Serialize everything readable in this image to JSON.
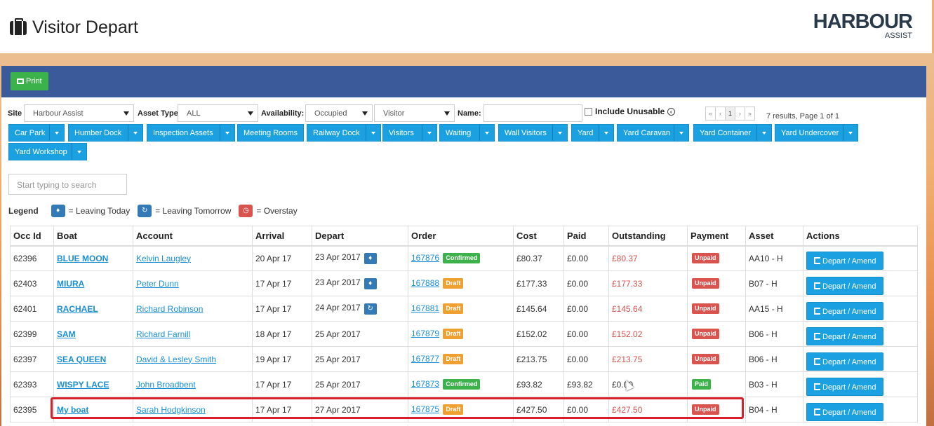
{
  "header": {
    "title": "Visitor Depart",
    "logo_main": "HARBOUR",
    "logo_sub": "ASSIST"
  },
  "toolbar": {
    "print_label": "Print"
  },
  "filters": {
    "site_label": "Site",
    "site_value": "Harbour Assist",
    "asset_type_label": "Asset Type",
    "asset_type_value": "ALL",
    "availability_label": "Availability:",
    "availability_value": "Occupied",
    "visitor_value": "Visitor",
    "name_label": "Name:",
    "name_value": "",
    "include_unusable_label": "Include Unusable",
    "results_text": "7 results, Page 1 of 1",
    "pager": [
      "«",
      "‹",
      "1",
      "›",
      "»"
    ]
  },
  "categories": [
    "Car Park",
    "Humber Dock",
    "Inspection Assets",
    "Meeting Rooms",
    "Railway Dock",
    "Visitors",
    "Waiting",
    "Wall Visitors",
    "Yard",
    "Yard Caravan",
    "Yard Container",
    "Yard Undercover",
    "Yard Workshop"
  ],
  "search": {
    "placeholder": "Start typing to search"
  },
  "legend": {
    "title": "Legend",
    "leaving_today": "= Leaving Today",
    "leaving_tomorrow": "= Leaving Tomorrow",
    "overstay": "= Overstay"
  },
  "table": {
    "headers": [
      "Occ Id",
      "Boat",
      "Account",
      "Arrival",
      "Depart",
      "Order",
      "Cost",
      "Paid",
      "Outstanding",
      "Payment",
      "Asset",
      "Actions"
    ],
    "action_label": "Depart / Amend",
    "rows": [
      {
        "occ": "62396",
        "boat": "BLUE MOON",
        "account": "Kelvin Laugley",
        "arrival": "20 Apr 17",
        "depart": "23 Apr 2017",
        "depart_icon": "bell-icon",
        "order": "167876",
        "status": "Confirmed",
        "cost": "£80.37",
        "paid": "£0.00",
        "outstanding": "£80.37",
        "payment": "Unpaid",
        "asset": "AA10 - H"
      },
      {
        "occ": "62403",
        "boat": "MIURA",
        "account": "Peter Dunn",
        "arrival": "17 Apr 17",
        "depart": "23 Apr 2017",
        "depart_icon": "bell-icon",
        "order": "167888",
        "status": "Draft",
        "cost": "£177.33",
        "paid": "£0.00",
        "outstanding": "£177.33",
        "payment": "Unpaid",
        "asset": "B07 - H"
      },
      {
        "occ": "62401",
        "boat": "RACHAEL",
        "account": "Richard Robinson",
        "arrival": "17 Apr 17",
        "depart": "24 Apr 2017",
        "depart_icon": "refresh-icon",
        "order": "167881",
        "status": "Draft",
        "cost": "£145.64",
        "paid": "£0.00",
        "outstanding": "£145.64",
        "payment": "Unpaid",
        "asset": "AA15 - H"
      },
      {
        "occ": "62399",
        "boat": "SAM",
        "account": "Richard Farnill",
        "arrival": "18 Apr 17",
        "depart": "25 Apr 2017",
        "depart_icon": "",
        "order": "167879",
        "status": "Draft",
        "cost": "£152.02",
        "paid": "£0.00",
        "outstanding": "£152.02",
        "payment": "Unpaid",
        "asset": "B06 - H"
      },
      {
        "occ": "62397",
        "boat": "SEA QUEEN",
        "account": "David & Lesley Smith",
        "arrival": "19 Apr 17",
        "depart": "25 Apr 2017",
        "depart_icon": "",
        "order": "167877",
        "status": "Draft",
        "cost": "£213.75",
        "paid": "£0.00",
        "outstanding": "£213.75",
        "payment": "Unpaid",
        "asset": "B06 - H"
      },
      {
        "occ": "62393",
        "boat": "WISPY LACE",
        "account": "John Broadbent",
        "arrival": "17 Apr 17",
        "depart": "25 Apr 2017",
        "depart_icon": "",
        "order": "167873",
        "status": "Confirmed",
        "cost": "£93.82",
        "paid": "£93.82",
        "outstanding": "£0.00",
        "payment": "Paid",
        "asset": "B03 - H"
      },
      {
        "occ": "62395",
        "boat": "My boat",
        "account": "Sarah Hodgkinson",
        "arrival": "17 Apr 17",
        "depart": "27 Apr 2017",
        "depart_icon": "",
        "order": "167875",
        "status": "Draft",
        "cost": "£427.50",
        "paid": "£0.00",
        "outstanding": "£427.50",
        "payment": "Unpaid",
        "asset": "B04 - H"
      }
    ]
  }
}
